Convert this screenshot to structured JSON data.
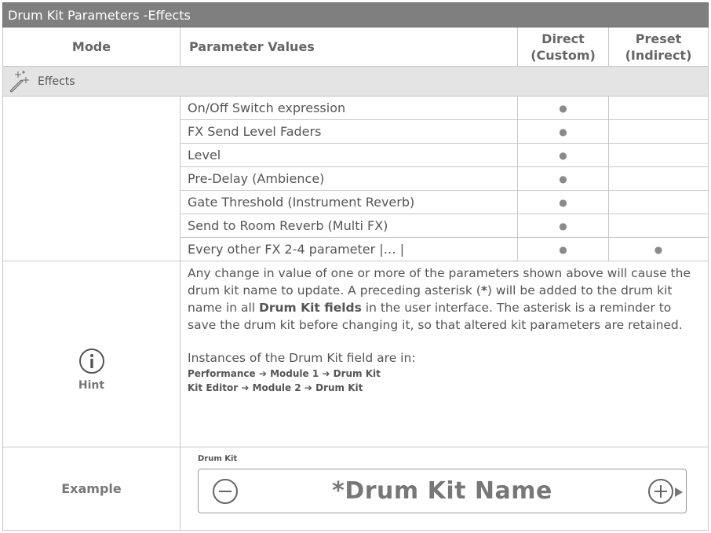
{
  "title": "Drum Kit Parameters -Effects",
  "headers": {
    "mode": "Mode",
    "values": "Parameter Values",
    "direct_line1": "Direct",
    "direct_line2": "(Custom)",
    "preset_line1": "Preset",
    "preset_line2": "(Indirect)"
  },
  "section": {
    "icon": "magic-wand-icon",
    "label": "Effects"
  },
  "rows": [
    {
      "label": "On/Off Switch expression",
      "direct": "●",
      "preset": ""
    },
    {
      "label": "FX Send Level Faders",
      "direct": "●",
      "preset": ""
    },
    {
      "label": "Level",
      "direct": "●",
      "preset": ""
    },
    {
      "label": "Pre-Delay (Ambience)",
      "direct": "●",
      "preset": ""
    },
    {
      "label": "Gate Threshold (Instrument Reverb)",
      "direct": "●",
      "preset": ""
    },
    {
      "label": "Send to Room Reverb (Multi FX)",
      "direct": "●",
      "preset": ""
    },
    {
      "label": "Every other FX 2-4 parameter |… |",
      "direct": "●",
      "preset": "●"
    }
  ],
  "hint": {
    "icon": "info-icon",
    "label": "Hint",
    "p1_a": "Any change in value of one or more of the parameters shown above will cause the drum kit name to update. A preceding asterisk (",
    "p1_asterisk": "*",
    "p1_b": ") will be added to the drum kit name in all ",
    "p1_bold": "Drum Kit fields",
    "p1_c": " in the user interface. The asterisk is a reminder to save the drum kit before changing it, so that altered kit parameters are retained.",
    "p2": "Instances of the Drum Kit field are in:",
    "path1": [
      "Performance",
      "Module 1",
      "Drum Kit"
    ],
    "path2": [
      "Kit Editor",
      "Module 2",
      "Drum Kit"
    ],
    "arrow": "➔"
  },
  "example": {
    "label": "Example",
    "field_label": "Drum Kit",
    "kit_name": "*Drum Kit Name",
    "minus_icon": "minus-circle-icon",
    "plus_icon": "plus-circle-icon",
    "play_icon": "play-triangle-icon"
  },
  "colors": {
    "title_bg": "#7f7f7f",
    "section_bg": "#e4e4e4",
    "border": "#c8c8c8",
    "text": "#555555"
  }
}
